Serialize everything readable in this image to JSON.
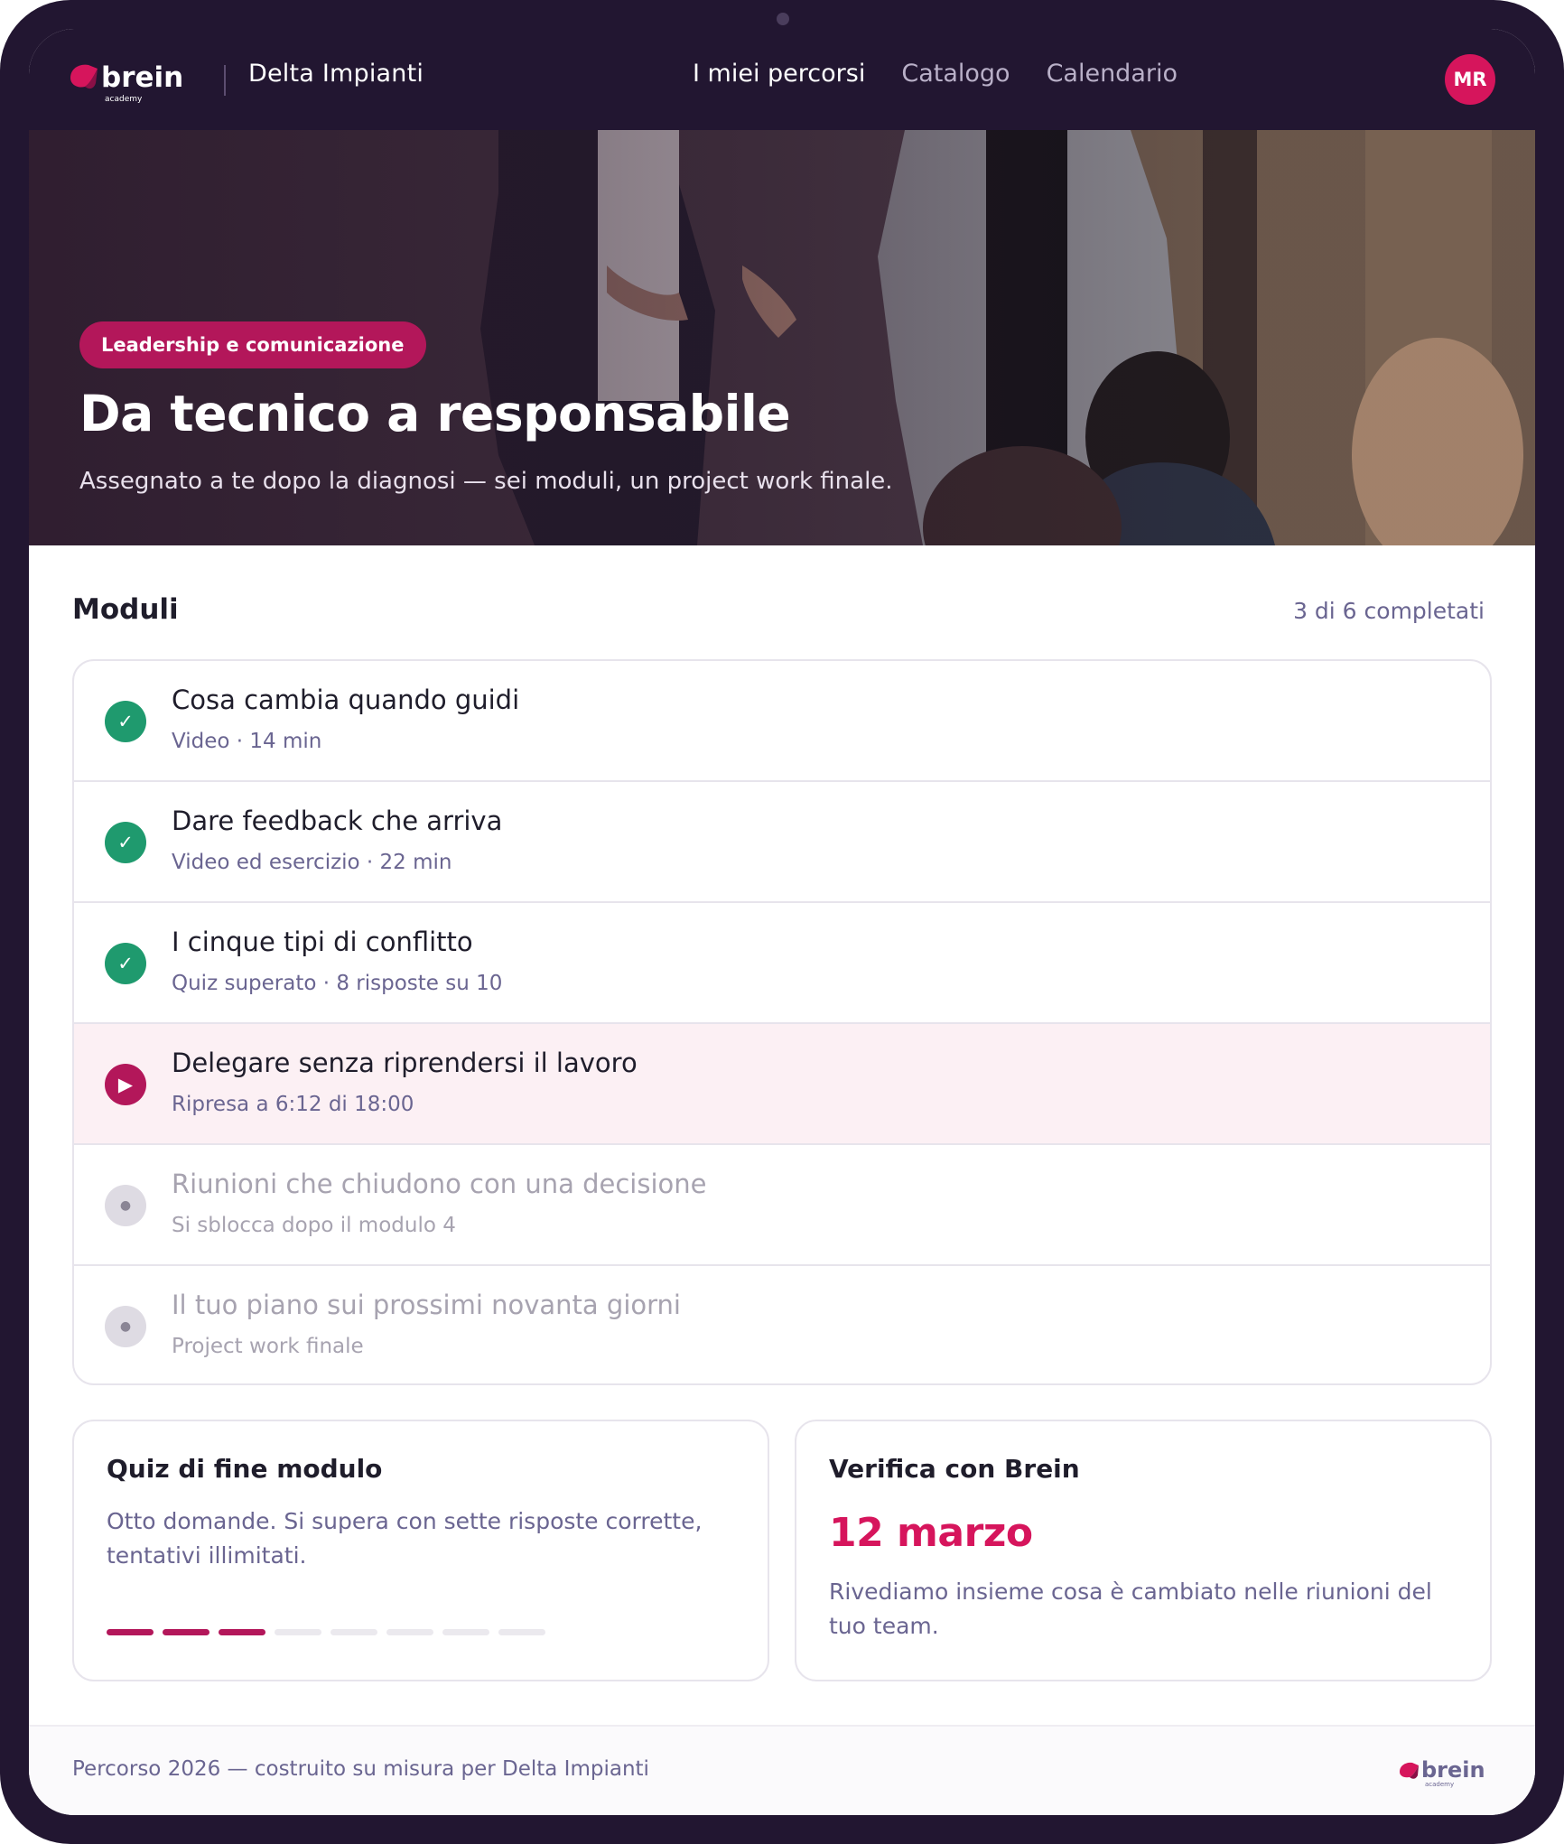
{
  "header": {
    "brand": "brein",
    "brand_sub": "academy",
    "company": "Delta Impianti",
    "nav": [
      {
        "label": "I miei percorsi",
        "active": true
      },
      {
        "label": "Catalogo",
        "active": false
      },
      {
        "label": "Calendario",
        "active": false
      }
    ],
    "avatar_initials": "MR"
  },
  "hero": {
    "badge": "Leadership e comunicazione",
    "title": "Da tecnico a responsabile",
    "subtitle": "Assegnato a te dopo la diagnosi — sei moduli, un project work finale."
  },
  "modules": {
    "title": "Moduli",
    "count": "3 di 6 completati",
    "items": [
      {
        "title": "Cosa cambia quando guidi",
        "meta": "Video · 14 min",
        "status": "done",
        "icon": "check-icon"
      },
      {
        "title": "Dare feedback che arriva",
        "meta": "Video ed esercizio · 22 min",
        "status": "done",
        "icon": "check-icon"
      },
      {
        "title": "I cinque tipi di conflitto",
        "meta": "Quiz superato · 8 risposte su 10",
        "status": "done",
        "icon": "check-icon"
      },
      {
        "title": "Delegare senza riprendersi il lavoro",
        "meta": "Ripresa a 6:12 di 18:00",
        "status": "current",
        "icon": "play-icon"
      },
      {
        "title": "Riunioni che chiudono con una decisione",
        "meta": "Si sblocca dopo il modulo 4",
        "status": "locked",
        "icon": "dot-icon"
      },
      {
        "title": "Il tuo piano sui prossimi novanta giorni",
        "meta": "Project work finale",
        "status": "locked",
        "icon": "dot-icon"
      }
    ]
  },
  "quiz_card": {
    "title": "Quiz di fine modulo",
    "text": "Otto domande. Si supera con sette risposte corrette, tentativi illimitati.",
    "progress": {
      "completed": 3,
      "total": 8
    }
  },
  "verify_card": {
    "title": "Verifica con Brein",
    "date": "12 marzo",
    "text": "Rivediamo insieme cosa è cambiato nelle riunioni del tuo team."
  },
  "footer": {
    "text": "Percorso 2026 — costruito su misura per Delta Impianti"
  },
  "colors": {
    "brand_dark": "#221631",
    "accent": "#d6155c",
    "accent_dark": "#b3175a",
    "success": "#1f9a6e",
    "muted_text": "#6a6591"
  }
}
